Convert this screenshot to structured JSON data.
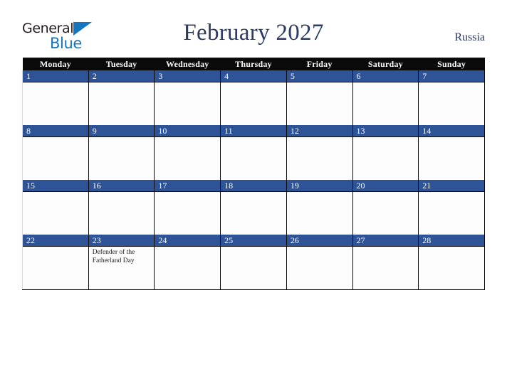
{
  "brand": {
    "name_part1": "General",
    "name_part2": "Blue",
    "triangle_icon": "blue-triangle-icon",
    "accent_color": "#1675bc",
    "text_color": "#231f20"
  },
  "header": {
    "title": "February 2027",
    "month": "February",
    "year": "2027",
    "country": "Russia",
    "title_color": "#2b3a62"
  },
  "calendar": {
    "weekday_headers": [
      "Monday",
      "Tuesday",
      "Wednesday",
      "Thursday",
      "Friday",
      "Saturday",
      "Sunday"
    ],
    "header_bg": "#0a0a0a",
    "daynum_bg": "#2e5396",
    "cell_bg": "#fdfdfd",
    "weeks": [
      [
        {
          "day": "1",
          "events": [
            "",
            ""
          ]
        },
        {
          "day": "2",
          "events": [
            "",
            ""
          ]
        },
        {
          "day": "3",
          "events": [
            "",
            ""
          ]
        },
        {
          "day": "4",
          "events": [
            "",
            ""
          ]
        },
        {
          "day": "5",
          "events": [
            "",
            ""
          ]
        },
        {
          "day": "6",
          "events": [
            "",
            ""
          ]
        },
        {
          "day": "7",
          "events": [
            "",
            ""
          ]
        }
      ],
      [
        {
          "day": "8",
          "events": [
            "",
            ""
          ]
        },
        {
          "day": "9",
          "events": [
            "",
            ""
          ]
        },
        {
          "day": "10",
          "events": [
            "",
            ""
          ]
        },
        {
          "day": "11",
          "events": [
            "",
            ""
          ]
        },
        {
          "day": "12",
          "events": [
            "",
            ""
          ]
        },
        {
          "day": "13",
          "events": [
            "",
            ""
          ]
        },
        {
          "day": "14",
          "events": [
            "",
            ""
          ]
        }
      ],
      [
        {
          "day": "15",
          "events": [
            "",
            ""
          ]
        },
        {
          "day": "16",
          "events": [
            "",
            ""
          ]
        },
        {
          "day": "17",
          "events": [
            "",
            ""
          ]
        },
        {
          "day": "18",
          "events": [
            "",
            ""
          ]
        },
        {
          "day": "19",
          "events": [
            "",
            ""
          ]
        },
        {
          "day": "20",
          "events": [
            "",
            ""
          ]
        },
        {
          "day": "21",
          "events": [
            "",
            ""
          ]
        }
      ],
      [
        {
          "day": "22",
          "events": [
            "",
            ""
          ]
        },
        {
          "day": "23",
          "events": [
            "Defender of the",
            "Fatherland Day"
          ]
        },
        {
          "day": "24",
          "events": [
            "",
            ""
          ]
        },
        {
          "day": "25",
          "events": [
            "",
            ""
          ]
        },
        {
          "day": "26",
          "events": [
            "",
            ""
          ]
        },
        {
          "day": "27",
          "events": [
            "",
            ""
          ]
        },
        {
          "day": "28",
          "events": [
            "",
            ""
          ]
        }
      ]
    ]
  }
}
